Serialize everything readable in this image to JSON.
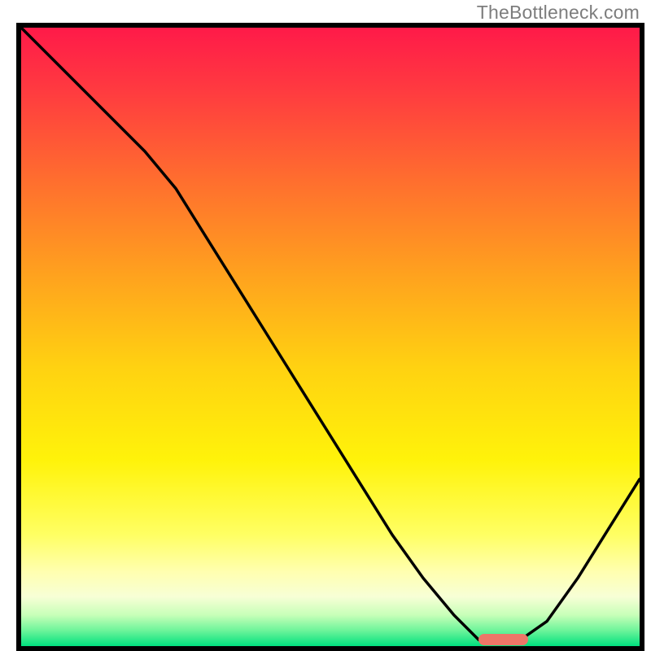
{
  "watermark": "TheBottleneck.com",
  "colors": {
    "frame": "#000000",
    "curve": "#000000",
    "marker": "#ed7668"
  },
  "chart_data": {
    "type": "line",
    "title": "",
    "xlabel": "",
    "ylabel": "",
    "xlim": [
      0,
      100
    ],
    "ylim": [
      0,
      100
    ],
    "x": [
      0,
      5,
      10,
      15,
      20,
      25,
      30,
      35,
      40,
      45,
      50,
      55,
      60,
      65,
      70,
      74,
      80,
      85,
      90,
      95,
      100
    ],
    "values": [
      100,
      95,
      90,
      85,
      80,
      74,
      66,
      58,
      50,
      42,
      34,
      26,
      18,
      11,
      5,
      1,
      0.5,
      4,
      11,
      19,
      27
    ],
    "marker": {
      "x_start": 74,
      "x_end": 82,
      "y": 1
    },
    "gradient_stops": [
      {
        "offset": 0.0,
        "color": "#ff1a49"
      },
      {
        "offset": 0.1,
        "color": "#ff3a40"
      },
      {
        "offset": 0.25,
        "color": "#ff6f2e"
      },
      {
        "offset": 0.4,
        "color": "#ffa21e"
      },
      {
        "offset": 0.55,
        "color": "#ffd211"
      },
      {
        "offset": 0.7,
        "color": "#fff30a"
      },
      {
        "offset": 0.82,
        "color": "#ffff63"
      },
      {
        "offset": 0.88,
        "color": "#ffffb0"
      },
      {
        "offset": 0.92,
        "color": "#f7ffd6"
      },
      {
        "offset": 0.95,
        "color": "#c7ffb8"
      },
      {
        "offset": 0.975,
        "color": "#6cf49a"
      },
      {
        "offset": 1.0,
        "color": "#00e07e"
      }
    ]
  }
}
